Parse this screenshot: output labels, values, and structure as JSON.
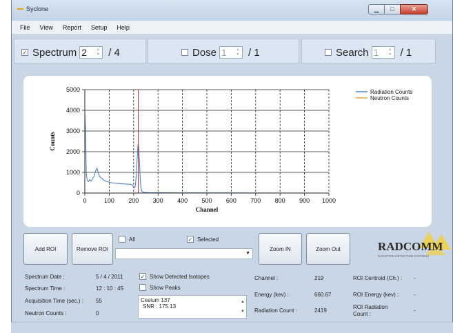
{
  "window": {
    "title": "Syclone"
  },
  "menu": [
    "File",
    "View",
    "Report",
    "Setup",
    "Help"
  ],
  "selectors": {
    "spectrum": {
      "checked": "✓",
      "label": "Spectrum",
      "value": "2",
      "total": "/ 4"
    },
    "dose": {
      "label": "Dose",
      "value": "1",
      "total": "/ 1"
    },
    "search": {
      "label": "Search",
      "value": "1",
      "total": "/ 1"
    }
  },
  "chart_data": {
    "type": "line",
    "xlabel": "Channel",
    "ylabel": "Counts",
    "xlim": [
      0,
      1000
    ],
    "ylim": [
      0,
      5000
    ],
    "x_ticks": [
      0,
      100,
      200,
      300,
      400,
      500,
      600,
      700,
      800,
      900,
      1000
    ],
    "y_ticks": [
      0,
      1000,
      2000,
      3000,
      4000,
      5000
    ],
    "grid": true,
    "legend": "top-right",
    "cursor_channel": 219,
    "series": [
      {
        "name": "Radiation Counts",
        "color": "#4a86c8",
        "points": [
          [
            0,
            3900
          ],
          [
            3,
            3000
          ],
          [
            6,
            1000
          ],
          [
            10,
            600
          ],
          [
            15,
            560
          ],
          [
            20,
            640
          ],
          [
            26,
            580
          ],
          [
            32,
            700
          ],
          [
            38,
            820
          ],
          [
            44,
            1050
          ],
          [
            50,
            1200
          ],
          [
            56,
            950
          ],
          [
            62,
            780
          ],
          [
            70,
            720
          ],
          [
            80,
            600
          ],
          [
            90,
            560
          ],
          [
            100,
            520
          ],
          [
            110,
            500
          ],
          [
            120,
            480
          ],
          [
            140,
            460
          ],
          [
            160,
            440
          ],
          [
            180,
            430
          ],
          [
            190,
            420
          ],
          [
            195,
            380
          ],
          [
            200,
            300
          ],
          [
            205,
            260
          ],
          [
            208,
            450
          ],
          [
            211,
            900
          ],
          [
            214,
            1600
          ],
          [
            217,
            2200
          ],
          [
            219,
            2400
          ],
          [
            221,
            2200
          ],
          [
            224,
            1500
          ],
          [
            227,
            700
          ],
          [
            230,
            250
          ],
          [
            234,
            80
          ],
          [
            240,
            30
          ],
          [
            260,
            20
          ],
          [
            400,
            10
          ],
          [
            600,
            5
          ],
          [
            1000,
            0
          ]
        ]
      },
      {
        "name": "Neutron Counts",
        "color": "#f0a830",
        "points": [
          [
            0,
            0
          ],
          [
            1000,
            0
          ]
        ]
      }
    ]
  },
  "controls": {
    "add_roi": "Add ROI",
    "remove_roi": "Remove ROI",
    "all": "All",
    "selected_mark": "✓",
    "selected": "Selected",
    "zoom_in": "Zoom IN",
    "zoom_out": "Zoom Out"
  },
  "logo": {
    "brand": "RADCOMM",
    "tagline": "RADIATION DETECTION SYSTEMS"
  },
  "info": {
    "spectrum_date_label": "Spectrum Date :",
    "spectrum_date": "5 / 4 / 2011",
    "spectrum_time_label": "Spectrum Time :",
    "spectrum_time": "12 : 10 : 45",
    "acq_time_label": "Acquisition Time (sec.) :",
    "acq_time": "55",
    "neutron_label": "Neutron Counts :",
    "neutron": "0",
    "show_isotopes_mark": "✓",
    "show_isotopes": "Show Detected Isotopes",
    "show_peaks": "Show Peaks",
    "isotope_name": "Cesium 137",
    "isotope_snr": "SNR : 175.13",
    "channel_label": "Channel :",
    "channel": "219",
    "energy_label": "Energy (kev) :",
    "energy": "660.67",
    "rad_count_label": "Radiation Count :",
    "rad_count": "2419",
    "roi_centroid_label": "ROI Centroid (Ch.) :",
    "roi_centroid": "-",
    "roi_energy_label": "ROI Energy (kev) :",
    "roi_energy": "-",
    "roi_radiation_label": "ROI Radiation Count :",
    "roi_radiation": "-"
  }
}
